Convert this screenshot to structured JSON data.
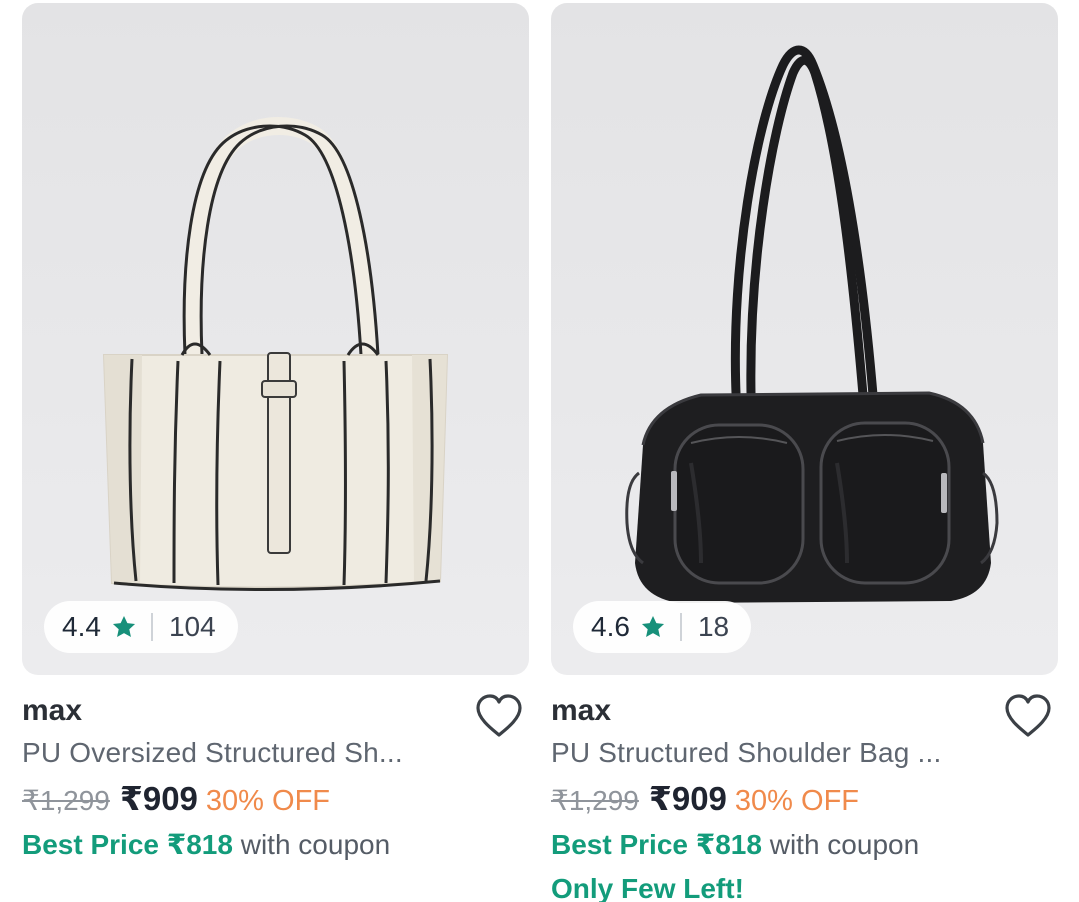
{
  "products": [
    {
      "brand": "max",
      "title": "PU Oversized Structured Sh...",
      "rating": "4.4",
      "rating_count": "104",
      "mrp": "₹1,299",
      "price": "₹909",
      "discount": "30% OFF",
      "best_price_label": "Best Price ₹818",
      "best_price_suffix": "with coupon",
      "stock_note": "",
      "image_alt": "white tote bag",
      "icons": [
        "star-icon",
        "heart-icon"
      ]
    },
    {
      "brand": "max",
      "title": "PU Structured Shoulder Bag ...",
      "rating": "4.6",
      "rating_count": "18",
      "mrp": "₹1,299",
      "price": "₹909",
      "discount": "30% OFF",
      "best_price_label": "Best Price ₹818",
      "best_price_suffix": "with coupon",
      "stock_note": "Only Few Left!",
      "image_alt": "black shoulder bag",
      "icons": [
        "star-icon",
        "heart-icon"
      ]
    }
  ],
  "colors": {
    "accent_green": "#139c7b",
    "discount_orange": "#f08a4b",
    "star_teal": "#17907a"
  }
}
